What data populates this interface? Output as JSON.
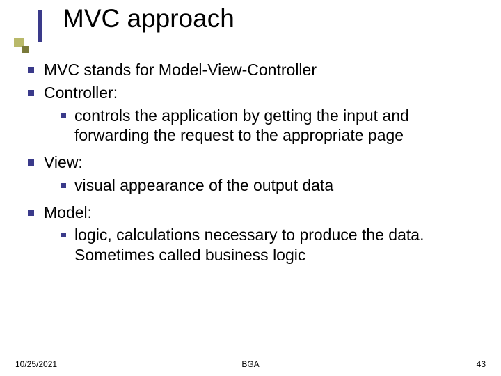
{
  "title": "MVC approach",
  "bullets": {
    "item1": "MVC stands for Model-View-Controller",
    "item2": "Controller:",
    "item2a": "controls the application by getting the input and forwarding the request to the appropriate page",
    "item3": "View:",
    "item3a": "visual appearance of the output data",
    "item4": "Model:",
    "item4a": "logic, calculations necessary to produce the data. Sometimes called business logic"
  },
  "footer": {
    "date": "10/25/2021",
    "center": "BGA",
    "pagenum": "43"
  }
}
